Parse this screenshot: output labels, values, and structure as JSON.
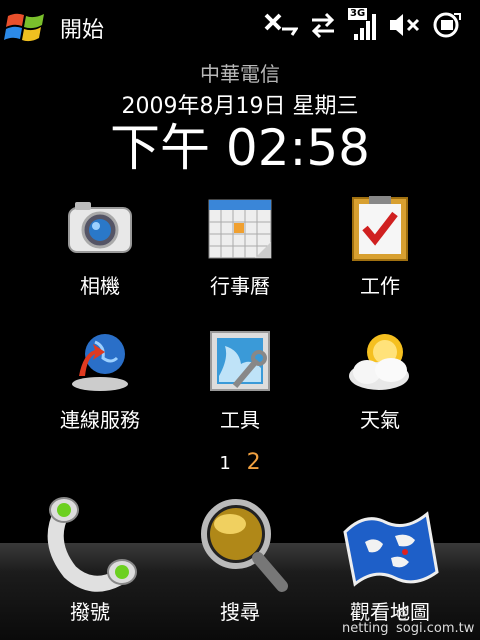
{
  "status_bar": {
    "start_label": "開始",
    "network_badge": "3G",
    "icons": [
      "windows-logo-icon",
      "data-sync-icon",
      "transfer-arrows-icon",
      "signal-strength-icon",
      "speaker-mute-icon",
      "battery-charging-icon"
    ]
  },
  "home": {
    "carrier": "中華電信",
    "date": "2009年8月19日 星期三",
    "time": "下午 02:58"
  },
  "apps": [
    {
      "label": "相機",
      "icon": "camera-icon"
    },
    {
      "label": "行事曆",
      "icon": "calendar-icon"
    },
    {
      "label": "工作",
      "icon": "task-clipboard-icon"
    },
    {
      "label": "連線服務",
      "icon": "globe-connection-icon"
    },
    {
      "label": "工具",
      "icon": "tools-icon"
    },
    {
      "label": "天氣",
      "icon": "weather-icon"
    }
  ],
  "pager": {
    "page1": "1",
    "page2": "2"
  },
  "dock": [
    {
      "label": "撥號",
      "icon": "phone-handset-icon"
    },
    {
      "label": "搜尋",
      "icon": "magnifier-icon"
    },
    {
      "label": "觀看地圖",
      "icon": "map-icon"
    }
  ],
  "watermark": {
    "left": "netting",
    "right": "@ sogi.com.tw"
  },
  "colors": {
    "background": "#000000",
    "active_page": "#f0a040",
    "carrier_text": "#b8b8b8"
  }
}
